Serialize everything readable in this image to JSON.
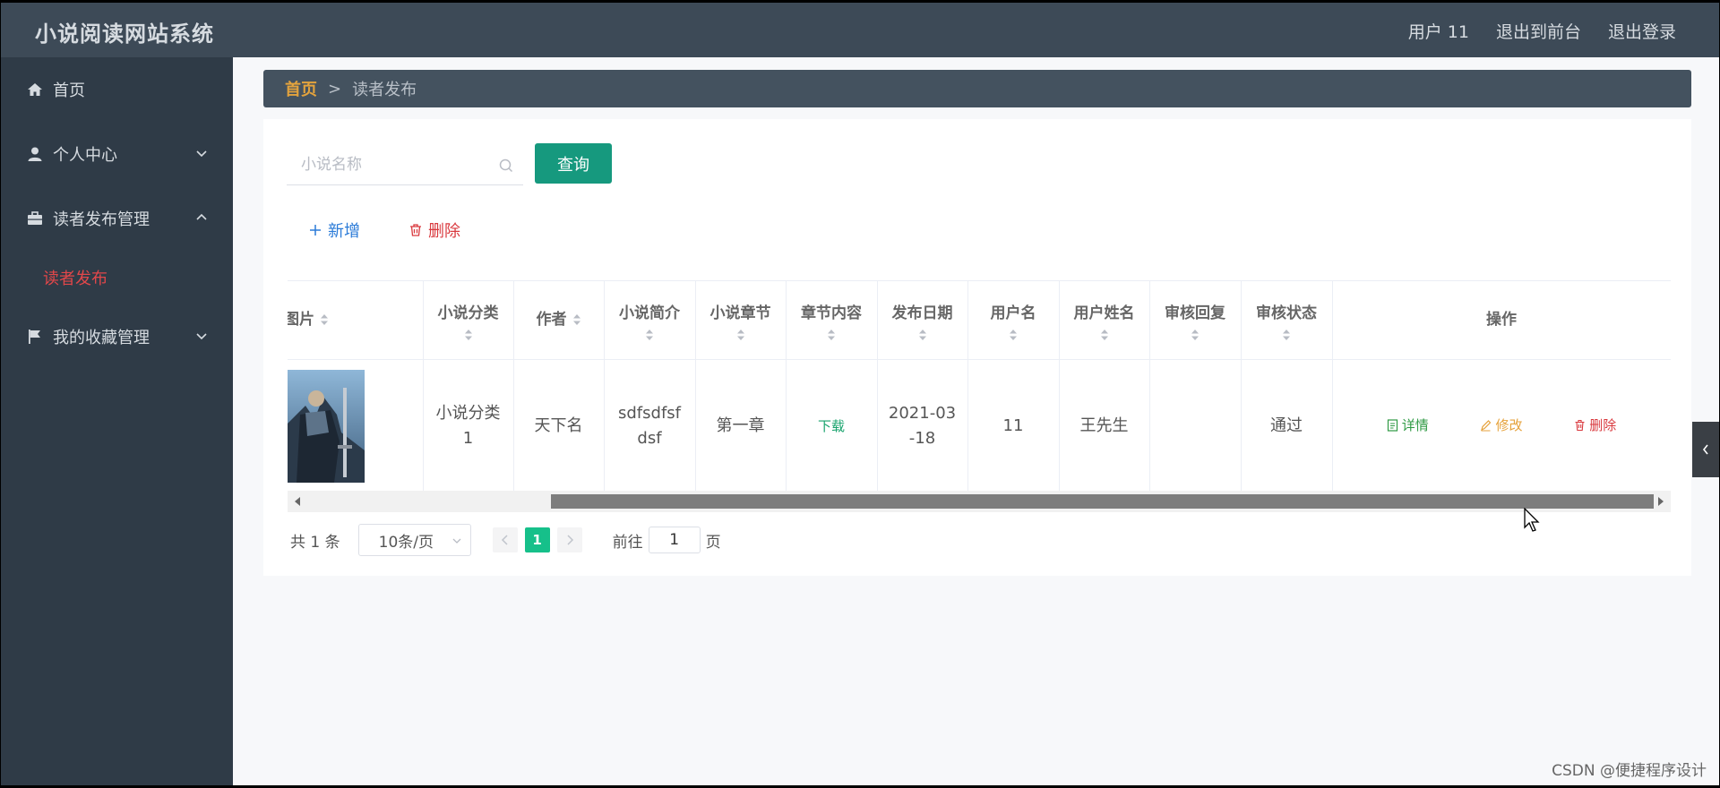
{
  "app": {
    "title": "小说阅读网站系统",
    "links": [
      "用户 11",
      "退出到前台",
      "退出登录"
    ]
  },
  "sidebar": {
    "items": [
      {
        "label": "首页",
        "icon": "home-icon"
      },
      {
        "label": "个人中心",
        "icon": "user-icon"
      },
      {
        "label": "读者发布管理",
        "icon": "briefcase-icon"
      },
      {
        "label": "我的收藏管理",
        "icon": "flag-icon"
      }
    ],
    "subitem": "读者发布"
  },
  "breadcrumb": {
    "home": "首页",
    "sep": ">",
    "current": "读者发布"
  },
  "search": {
    "placeholder": "小说名称",
    "value": "",
    "button": "查询"
  },
  "actions": {
    "add": "新增",
    "delete": "删除"
  },
  "table": {
    "headers": [
      "图片",
      "小说分类",
      "作者",
      "小说简介",
      "小说章节",
      "章节内容",
      "发布日期",
      "用户名",
      "用户姓名",
      "审核回复",
      "审核状态",
      "操作"
    ],
    "header_visible_first": "图片",
    "row": {
      "category": "小说分类1",
      "author": "天下名",
      "intro": "sdfsdfsfdsf",
      "chapter": "第一章",
      "content": "下载",
      "date": "2021-03-18",
      "username": "11",
      "realname": "王先生",
      "reply": "",
      "status": "通过"
    },
    "ops": {
      "detail": "详情",
      "edit": "修改",
      "delete": "删除"
    }
  },
  "pagination": {
    "total": "共 1 条",
    "page_size": "10条/页",
    "current": "1",
    "goto_prefix": "前往",
    "goto_value": "1",
    "goto_suffix": "页"
  },
  "watermark": "CSDN @便捷程序设计",
  "colors": {
    "header": "#3d4a57",
    "sidebar": "#2f3b47",
    "primary": "#16997e",
    "active": "#e2474a"
  }
}
